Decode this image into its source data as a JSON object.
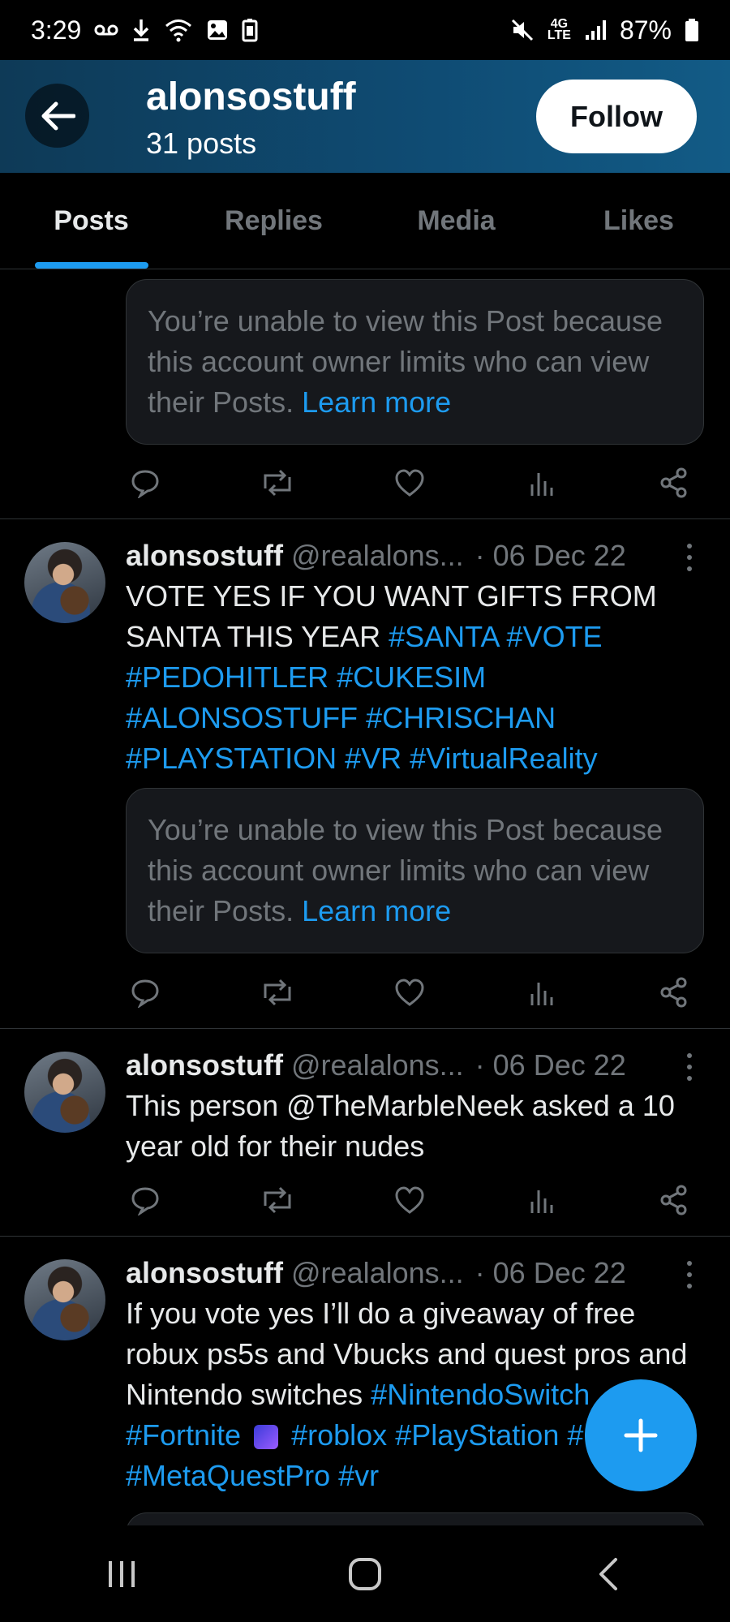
{
  "status_bar": {
    "time": "3:29",
    "battery": "87%",
    "left_icons": [
      "voicemail-icon",
      "download-icon",
      "wifi-icon",
      "image-icon",
      "battery-saver-icon"
    ],
    "right_icons": [
      "mute-icon",
      "4g-lte-icon",
      "signal-icon",
      "battery-icon"
    ]
  },
  "header": {
    "name": "alonsostuff",
    "post_count": "31 posts",
    "follow_label": "Follow"
  },
  "tabs": [
    {
      "label": "Posts",
      "active": true
    },
    {
      "label": "Replies",
      "active": false
    },
    {
      "label": "Media",
      "active": false
    },
    {
      "label": "Likes",
      "active": false
    }
  ],
  "limited_notice": {
    "text": "You’re unable to view this Post because this account owner limits who can view their Posts.",
    "link": "Learn more"
  },
  "posts": [
    {
      "author": "alonsostuff",
      "handle": "@realalons...",
      "date": "· 06 Dec 22",
      "text_plain": "VOTE YES IF YOU WANT GIFTS FROM SANTA THIS YEAR",
      "hashtags": [
        "#SANTA",
        "#VOTE",
        "#PEDOHITLER",
        "#CUKESIM",
        "#ALONSOSTUFF",
        "#CHRISCHAN",
        "#PLAYSTATION",
        "#VR",
        "#VirtualReality"
      ]
    },
    {
      "author": "alonsostuff",
      "handle": "@realalons...",
      "date": "· 06 Dec 22",
      "text": "This person @TheMarbleNeek asked a 10 year old for their nudes"
    },
    {
      "author": "alonsostuff",
      "handle": "@realalons...",
      "date": "· 06 Dec 22",
      "text_plain": "If you vote yes I’ll do a giveaway of free robux ps5s and Vbucks and quest pros and Nintendo switches",
      "hashtags": [
        "#NintendoSwitch",
        "#Fortnite",
        "#roblox",
        "#PlayStation",
        "#Oculus",
        "#MetaQuestPro",
        "#vr"
      ]
    }
  ]
}
